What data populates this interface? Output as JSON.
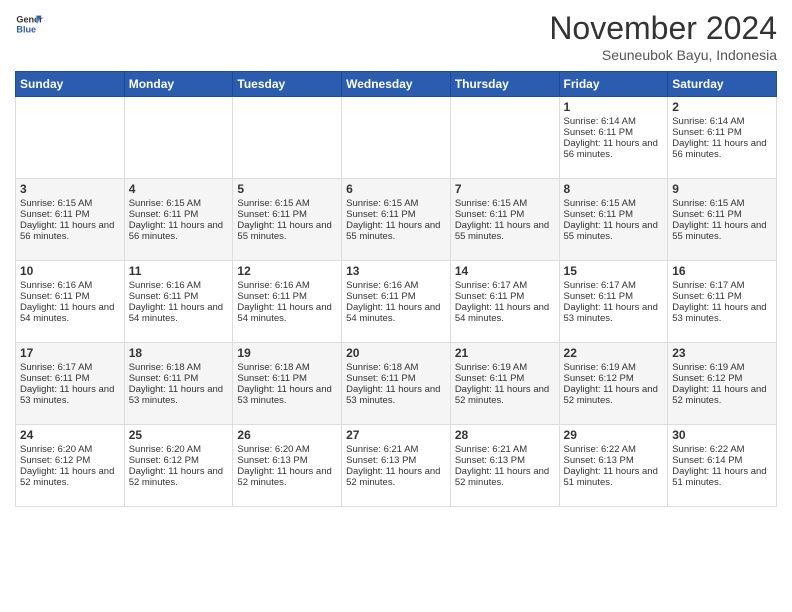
{
  "logo": {
    "line1": "General",
    "line2": "Blue"
  },
  "title": "November 2024",
  "location": "Seuneubok Bayu, Indonesia",
  "days_header": [
    "Sunday",
    "Monday",
    "Tuesday",
    "Wednesday",
    "Thursday",
    "Friday",
    "Saturday"
  ],
  "weeks": [
    [
      {
        "day": "",
        "info": ""
      },
      {
        "day": "",
        "info": ""
      },
      {
        "day": "",
        "info": ""
      },
      {
        "day": "",
        "info": ""
      },
      {
        "day": "",
        "info": ""
      },
      {
        "day": "1",
        "info": "Sunrise: 6:14 AM\nSunset: 6:11 PM\nDaylight: 11 hours and 56 minutes."
      },
      {
        "day": "2",
        "info": "Sunrise: 6:14 AM\nSunset: 6:11 PM\nDaylight: 11 hours and 56 minutes."
      }
    ],
    [
      {
        "day": "3",
        "info": "Sunrise: 6:15 AM\nSunset: 6:11 PM\nDaylight: 11 hours and 56 minutes."
      },
      {
        "day": "4",
        "info": "Sunrise: 6:15 AM\nSunset: 6:11 PM\nDaylight: 11 hours and 56 minutes."
      },
      {
        "day": "5",
        "info": "Sunrise: 6:15 AM\nSunset: 6:11 PM\nDaylight: 11 hours and 55 minutes."
      },
      {
        "day": "6",
        "info": "Sunrise: 6:15 AM\nSunset: 6:11 PM\nDaylight: 11 hours and 55 minutes."
      },
      {
        "day": "7",
        "info": "Sunrise: 6:15 AM\nSunset: 6:11 PM\nDaylight: 11 hours and 55 minutes."
      },
      {
        "day": "8",
        "info": "Sunrise: 6:15 AM\nSunset: 6:11 PM\nDaylight: 11 hours and 55 minutes."
      },
      {
        "day": "9",
        "info": "Sunrise: 6:15 AM\nSunset: 6:11 PM\nDaylight: 11 hours and 55 minutes."
      }
    ],
    [
      {
        "day": "10",
        "info": "Sunrise: 6:16 AM\nSunset: 6:11 PM\nDaylight: 11 hours and 54 minutes."
      },
      {
        "day": "11",
        "info": "Sunrise: 6:16 AM\nSunset: 6:11 PM\nDaylight: 11 hours and 54 minutes."
      },
      {
        "day": "12",
        "info": "Sunrise: 6:16 AM\nSunset: 6:11 PM\nDaylight: 11 hours and 54 minutes."
      },
      {
        "day": "13",
        "info": "Sunrise: 6:16 AM\nSunset: 6:11 PM\nDaylight: 11 hours and 54 minutes."
      },
      {
        "day": "14",
        "info": "Sunrise: 6:17 AM\nSunset: 6:11 PM\nDaylight: 11 hours and 54 minutes."
      },
      {
        "day": "15",
        "info": "Sunrise: 6:17 AM\nSunset: 6:11 PM\nDaylight: 11 hours and 53 minutes."
      },
      {
        "day": "16",
        "info": "Sunrise: 6:17 AM\nSunset: 6:11 PM\nDaylight: 11 hours and 53 minutes."
      }
    ],
    [
      {
        "day": "17",
        "info": "Sunrise: 6:17 AM\nSunset: 6:11 PM\nDaylight: 11 hours and 53 minutes."
      },
      {
        "day": "18",
        "info": "Sunrise: 6:18 AM\nSunset: 6:11 PM\nDaylight: 11 hours and 53 minutes."
      },
      {
        "day": "19",
        "info": "Sunrise: 6:18 AM\nSunset: 6:11 PM\nDaylight: 11 hours and 53 minutes."
      },
      {
        "day": "20",
        "info": "Sunrise: 6:18 AM\nSunset: 6:11 PM\nDaylight: 11 hours and 53 minutes."
      },
      {
        "day": "21",
        "info": "Sunrise: 6:19 AM\nSunset: 6:11 PM\nDaylight: 11 hours and 52 minutes."
      },
      {
        "day": "22",
        "info": "Sunrise: 6:19 AM\nSunset: 6:12 PM\nDaylight: 11 hours and 52 minutes."
      },
      {
        "day": "23",
        "info": "Sunrise: 6:19 AM\nSunset: 6:12 PM\nDaylight: 11 hours and 52 minutes."
      }
    ],
    [
      {
        "day": "24",
        "info": "Sunrise: 6:20 AM\nSunset: 6:12 PM\nDaylight: 11 hours and 52 minutes."
      },
      {
        "day": "25",
        "info": "Sunrise: 6:20 AM\nSunset: 6:12 PM\nDaylight: 11 hours and 52 minutes."
      },
      {
        "day": "26",
        "info": "Sunrise: 6:20 AM\nSunset: 6:13 PM\nDaylight: 11 hours and 52 minutes."
      },
      {
        "day": "27",
        "info": "Sunrise: 6:21 AM\nSunset: 6:13 PM\nDaylight: 11 hours and 52 minutes."
      },
      {
        "day": "28",
        "info": "Sunrise: 6:21 AM\nSunset: 6:13 PM\nDaylight: 11 hours and 52 minutes."
      },
      {
        "day": "29",
        "info": "Sunrise: 6:22 AM\nSunset: 6:13 PM\nDaylight: 11 hours and 51 minutes."
      },
      {
        "day": "30",
        "info": "Sunrise: 6:22 AM\nSunset: 6:14 PM\nDaylight: 11 hours and 51 minutes."
      }
    ]
  ]
}
